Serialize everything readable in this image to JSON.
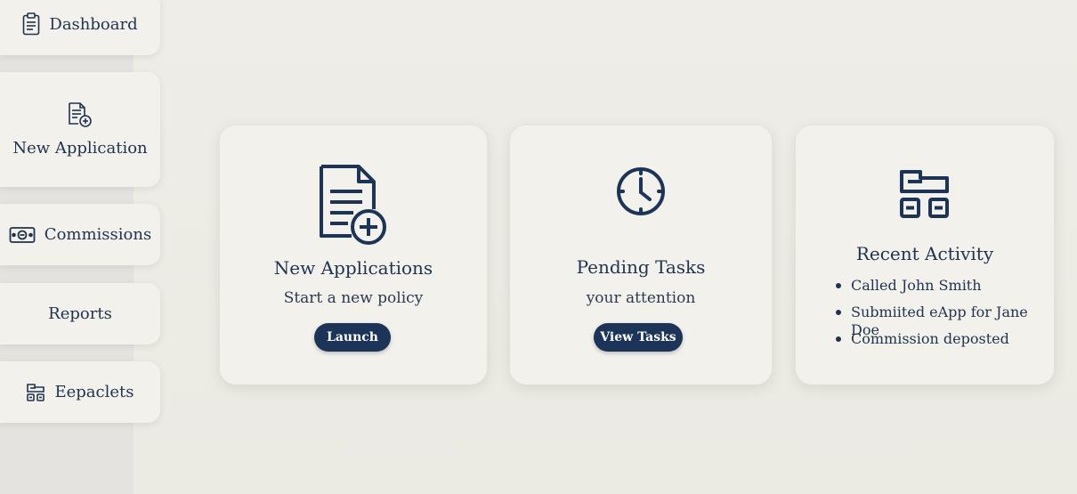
{
  "sidebar": {
    "items": [
      {
        "label": "Dashboard",
        "icon": "clipboard-icon"
      },
      {
        "label": "New Application",
        "icon": "document-plus-icon"
      },
      {
        "label": "Commissions",
        "icon": "money-icon"
      },
      {
        "label": "Reports"
      },
      {
        "label": "Eepaclets",
        "icon": "layout-icon"
      }
    ]
  },
  "cards": {
    "new_applications": {
      "title": "New Applications",
      "subtitle": "Start a new policy",
      "button": "Launch",
      "icon": "document-plus-icon"
    },
    "pending_tasks": {
      "title": "Pending Tasks",
      "subtitle": "your attention",
      "button": "View Tasks",
      "icon": "clock-icon"
    },
    "recent_activity": {
      "title": "Recent Activity",
      "icon": "layout-icon",
      "items": [
        "Called John Smith",
        "Submiited eApp for Jane Doe",
        "Commission deposted"
      ]
    }
  },
  "colors": {
    "accent": "#1b3457",
    "text": "#1f3350",
    "card": "#f3f1eb",
    "background": "#ecebe4"
  }
}
